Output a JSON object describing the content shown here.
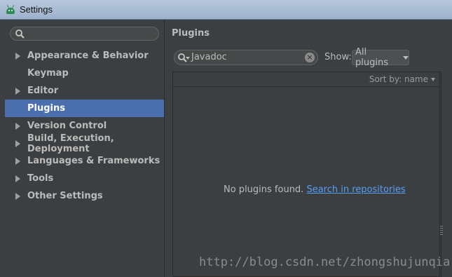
{
  "window": {
    "title": "Settings"
  },
  "sidebar": {
    "search_placeholder": "",
    "items": [
      {
        "label": "Appearance & Behavior",
        "expandable": true,
        "selected": false
      },
      {
        "label": "Keymap",
        "expandable": false,
        "selected": false
      },
      {
        "label": "Editor",
        "expandable": true,
        "selected": false
      },
      {
        "label": "Plugins",
        "expandable": false,
        "selected": true
      },
      {
        "label": "Version Control",
        "expandable": true,
        "selected": false
      },
      {
        "label": "Build, Execution, Deployment",
        "expandable": true,
        "selected": false
      },
      {
        "label": "Languages & Frameworks",
        "expandable": true,
        "selected": false
      },
      {
        "label": "Tools",
        "expandable": true,
        "selected": false
      },
      {
        "label": "Other Settings",
        "expandable": true,
        "selected": false
      }
    ]
  },
  "main": {
    "title": "Plugins",
    "filter": {
      "value": "Javadoc",
      "icons": [
        "search-icon",
        "clear-icon"
      ]
    },
    "show": {
      "label": "Show:",
      "selected": "All plugins"
    },
    "list": {
      "sort_label": "Sort by: name",
      "empty_text": "No plugins found.",
      "empty_link": "Search in repositories"
    }
  },
  "watermark": "http://blog.csdn.net/zhongshujunqia",
  "colors": {
    "selection": "#4b6eaf",
    "link": "#589df6",
    "background": "#3c3f41"
  }
}
